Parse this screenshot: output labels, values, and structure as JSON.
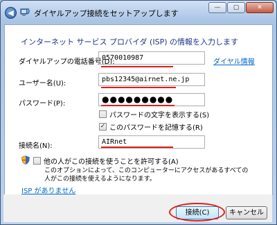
{
  "window": {
    "title": "ダイヤルアップ接続をセットアップします",
    "minimize": "—",
    "maximize": "▢",
    "close": "✕"
  },
  "nav": {
    "back_glyph": "◀"
  },
  "form": {
    "heading": "インターネット サービス プロバイダ (ISP) の情報を入力します",
    "phone_label": "ダイヤルアップの電話番号(D):",
    "phone_value": "0570010987",
    "dialing_rules_link": "ダイヤル情報",
    "username_label": "ユーザー名(U):",
    "username_value": "pbs12345@airnet.ne.jp",
    "password_label": "パスワード(P):",
    "password_value": "●●●●●●●●●",
    "show_password_label": "パスワードの文字を表示する(S)",
    "remember_password_label": "このパスワードを記憶する(R)",
    "remember_password_mark": "✓",
    "connection_name_label": "接続名(N):",
    "connection_name_value": "AIRnet",
    "allow_others_label": "他の人がこの接続を使うことを許可する(A)",
    "allow_others_desc": "このオプションによって、このコンピューターにアクセスがあるすべての人がこの接続を使えるようになります。",
    "no_isp_link": "ISP がありません"
  },
  "buttons": {
    "connect": "接続(C)",
    "cancel": "キャンセル"
  },
  "colors": {
    "annotation_red": "#e31b1b",
    "link_blue": "#0066cc",
    "heading_blue": "#1e3287"
  }
}
